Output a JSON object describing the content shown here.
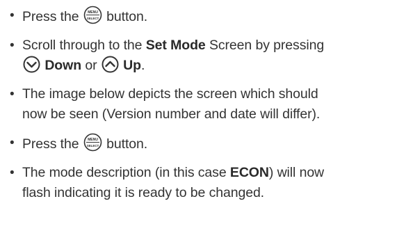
{
  "instructions": [
    {
      "before": "Press the",
      "icon_text_top": "MENU",
      "icon_text_bottom": "SELECT",
      "after": "button."
    },
    {
      "pre": "Scroll through to the",
      "bold1": "Set Mode",
      "mid": "Screen by pressing",
      "bold2": "Down",
      "or": "or",
      "bold3": "Up",
      "end": "."
    },
    {
      "line1": "The image below depicts the screen which should",
      "line2": "now be seen (Version number and date will differ)."
    },
    {
      "before": "Press the",
      "icon_text_top": "MENU",
      "icon_text_bottom": "SELECT",
      "after": "button."
    },
    {
      "pre": "The mode description (in this case",
      "bold": "ECON",
      "post": ") will now",
      "line2": "flash indicating it is ready to be changed."
    }
  ],
  "bullet_char": "•",
  "icons": {
    "menu": "menu-select-button-icon",
    "down": "chevron-down-circle-icon",
    "up": "chevron-up-circle-icon"
  }
}
